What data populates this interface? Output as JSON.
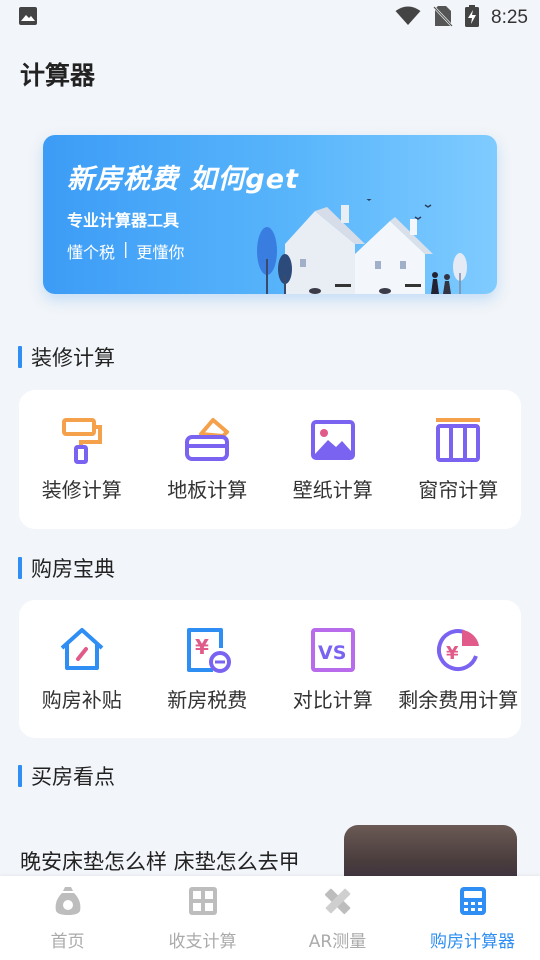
{
  "status": {
    "time": "8:25"
  },
  "header": {
    "title": "计算器"
  },
  "banner": {
    "headline": "新房税费 如何get",
    "subtitle": "专业计算器工具",
    "link_left": "懂个税",
    "divider": "|",
    "link_right": "更懂你"
  },
  "sections": {
    "renovation": {
      "title": "装修计算",
      "items": [
        {
          "label": "装修计算",
          "icon": "paint-roller-icon"
        },
        {
          "label": "地板计算",
          "icon": "floor-icon"
        },
        {
          "label": "壁纸计算",
          "icon": "wallpaper-image-icon"
        },
        {
          "label": "窗帘计算",
          "icon": "curtain-icon"
        }
      ]
    },
    "buying": {
      "title": "购房宝典",
      "items": [
        {
          "label": "购房补贴",
          "icon": "house-subsidy-icon"
        },
        {
          "label": "新房税费",
          "icon": "yuan-tax-icon"
        },
        {
          "label": "对比计算",
          "icon": "vs-compare-icon"
        },
        {
          "label": "剩余费用计算",
          "icon": "yuan-pie-icon"
        }
      ]
    },
    "highlights": {
      "title": "买房看点",
      "article_title": "晚安床垫怎么样 床垫怎么去甲"
    }
  },
  "tabbar": {
    "items": [
      {
        "label": "首页",
        "icon": "money-bag-icon",
        "active": false
      },
      {
        "label": "收支计算",
        "icon": "calculator-grid-icon",
        "active": false
      },
      {
        "label": "AR测量",
        "icon": "ruler-pencil-icon",
        "active": false
      },
      {
        "label": "购房计算器",
        "icon": "calculator-icon",
        "active": true
      }
    ]
  },
  "colors": {
    "accent": "#2f8ef3",
    "orange": "#f5a04a",
    "purple": "#7b63f2",
    "pink": "#e05a8a"
  }
}
